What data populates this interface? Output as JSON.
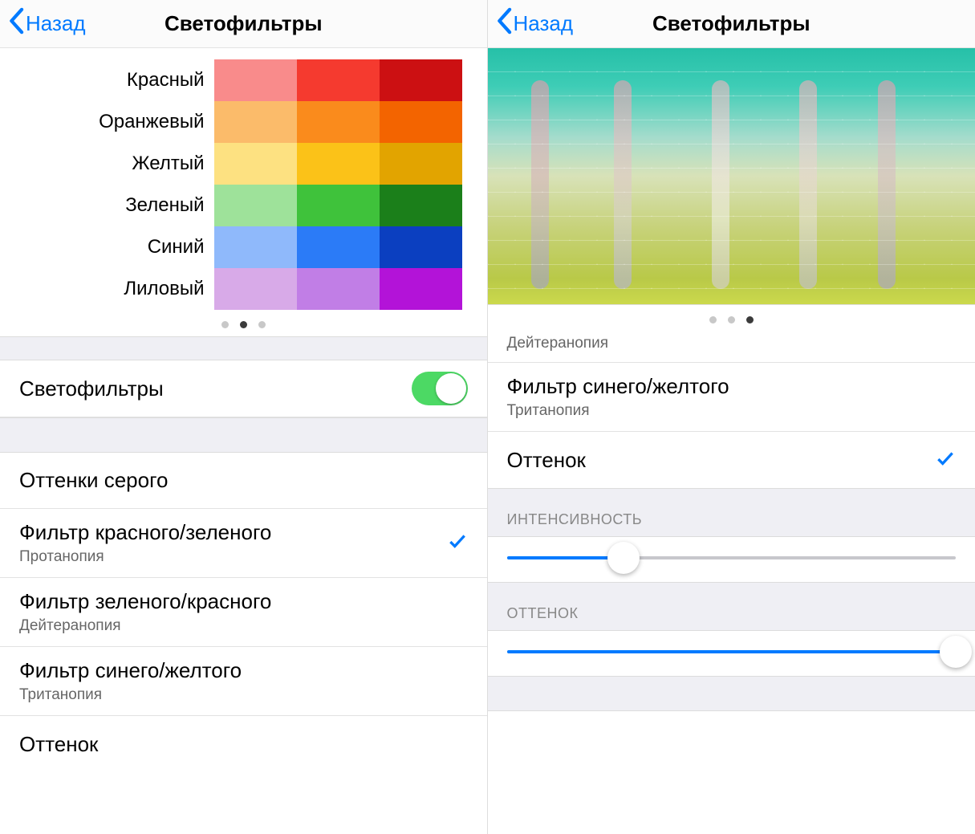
{
  "nav": {
    "back_label": "Назад",
    "title": "Светофильтры"
  },
  "left": {
    "swatches": {
      "rows": [
        {
          "label": "Красный",
          "light": "#f98b8b",
          "mid": "#f53a2f",
          "dark": "#cc1012"
        },
        {
          "label": "Оранжевый",
          "light": "#fbbb6a",
          "mid": "#fa8b1c",
          "dark": "#f36400"
        },
        {
          "label": "Желтый",
          "light": "#fde181",
          "mid": "#fbc218",
          "dark": "#e2a400"
        },
        {
          "label": "Зеленый",
          "light": "#9ee29a",
          "mid": "#3fc23b",
          "dark": "#1b7f1a"
        },
        {
          "label": "Синий",
          "light": "#8fb9fb",
          "mid": "#2b7bf7",
          "dark": "#0b3fc0"
        },
        {
          "label": "Лиловый",
          "light": "#d8aae8",
          "mid": "#c17ee6",
          "dark": "#b313d8"
        }
      ]
    },
    "page_indicator": {
      "count": 3,
      "active": 1
    },
    "toggle": {
      "label": "Светофильтры",
      "on": true
    },
    "options": [
      {
        "title": "Оттенки серого",
        "sub": "",
        "selected": false
      },
      {
        "title": "Фильтр красного/зеленого",
        "sub": "Протанопия",
        "selected": true
      },
      {
        "title": "Фильтр зеленого/красного",
        "sub": "Дейтеранопия",
        "selected": false
      },
      {
        "title": "Фильтр синего/желтого",
        "sub": "Тританопия",
        "selected": false
      },
      {
        "title": "Оттенок",
        "sub": "",
        "selected": false
      }
    ]
  },
  "right": {
    "page_indicator": {
      "count": 3,
      "active": 2
    },
    "partial_sub": "Дейтеранопия",
    "options": [
      {
        "title": "Фильтр синего/желтого",
        "sub": "Тританопия",
        "selected": false
      },
      {
        "title": "Оттенок",
        "sub": "",
        "selected": true
      }
    ],
    "stripes": [
      {
        "left_pct": 9,
        "gradient": [
          "#f497ab",
          "#dfb0b5",
          "#c4b5c2",
          "#a09ed0"
        ]
      },
      {
        "left_pct": 26,
        "gradient": [
          "#f09fb1",
          "#e3c1c2",
          "#d6d2ce",
          "#b3b0db"
        ]
      },
      {
        "left_pct": 46,
        "gradient": [
          "#f5b5bf",
          "#efdedc",
          "#efefe6",
          "#d3cddc"
        ]
      },
      {
        "left_pct": 64,
        "gradient": [
          "#f4adb8",
          "#ead0cf",
          "#e4dfd4",
          "#c0bdda"
        ]
      },
      {
        "left_pct": 80,
        "gradient": [
          "#f09baf",
          "#debcc0",
          "#c9beca",
          "#a8a0d4"
        ]
      }
    ],
    "intensity": {
      "header": "ИНТЕНСИВНОСТЬ",
      "value": 0.26
    },
    "hue": {
      "header": "ОТТЕНОК",
      "value": 1.0
    }
  }
}
